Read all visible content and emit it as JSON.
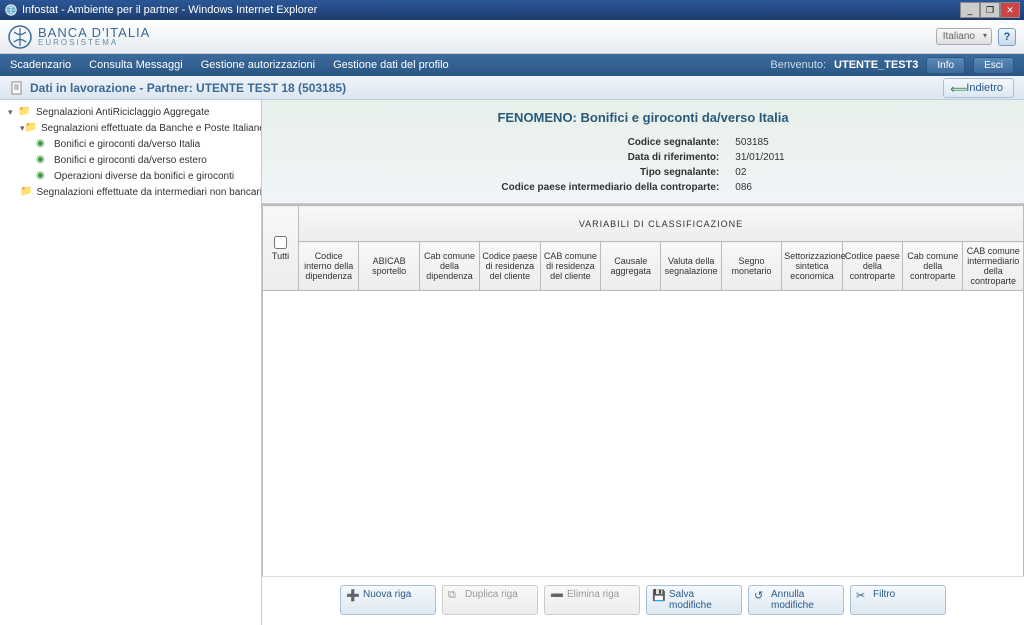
{
  "window": {
    "title": "Infostat - Ambiente per il partner - Windows Internet Explorer"
  },
  "brand": {
    "name": "BANCA D'ITALIA",
    "sub": "EUROSISTEMA"
  },
  "lang": {
    "selected": "Italiano"
  },
  "nav": {
    "items": [
      "Scadenzario",
      "Consulta Messaggi",
      "Gestione autorizzazioni",
      "Gestione dati del profilo"
    ],
    "welcome": "Benvenuto:",
    "user": "UTENTE_TEST3",
    "info_btn": "Info",
    "exit_btn": "Esci"
  },
  "breadcrumb": {
    "text": "Dati in lavorazione - Partner: UTENTE TEST 18 (503185)",
    "back_btn": "Indietro"
  },
  "tree": {
    "n0": "Segnalazioni AntiRiciclaggio Aggregate",
    "n1": "Segnalazioni effettuate da Banche e Poste Italiane",
    "n2": "Bonifici e giroconti da/verso Italia",
    "n3": "Bonifici e giroconti da/verso estero",
    "n4": "Operazioni diverse da bonifici e giroconti",
    "n5": "Segnalazioni effettuate da intermediari non bancari"
  },
  "header": {
    "phenom_prefix": "FENOMENO:",
    "phenom_name": "Bonifici e giroconti da/verso Italia",
    "rows": {
      "cod_seg_lbl": "Codice segnalante:",
      "cod_seg_val": "503185",
      "data_rif_lbl": "Data di riferimento:",
      "data_rif_val": "31/01/2011",
      "tipo_seg_lbl": "Tipo segnalante:",
      "tipo_seg_val": "02",
      "cod_paese_lbl": "Codice paese intermediario della controparte:",
      "cod_paese_val": "086"
    }
  },
  "grid": {
    "group_header": "VARIABILI DI CLASSIFICAZIONE",
    "tutti": "Tutti",
    "cols": {
      "c0": "Codice interno della dipendenza",
      "c1": "ABICAB sportello",
      "c2": "Cab comune della dipendenza",
      "c3": "Codice paese di residenza del cliente",
      "c4": "CAB comune di residenza del cliente",
      "c5": "Causale aggregata",
      "c6": "Valuta della segnalazione",
      "c7": "Segno monetario",
      "c8": "Settorizzazione sintetica economica",
      "c9": "Codice paese della controparte",
      "c10": "Cab comune della controparte",
      "c11": "CAB comune intermediario della controparte"
    }
  },
  "footer": {
    "new_row": "Nuova riga",
    "dup_row": "Duplica riga",
    "del_row": "Elimina riga",
    "save": "Salva modifiche",
    "cancel": "Annulla modifiche",
    "filter": "Filtro"
  }
}
